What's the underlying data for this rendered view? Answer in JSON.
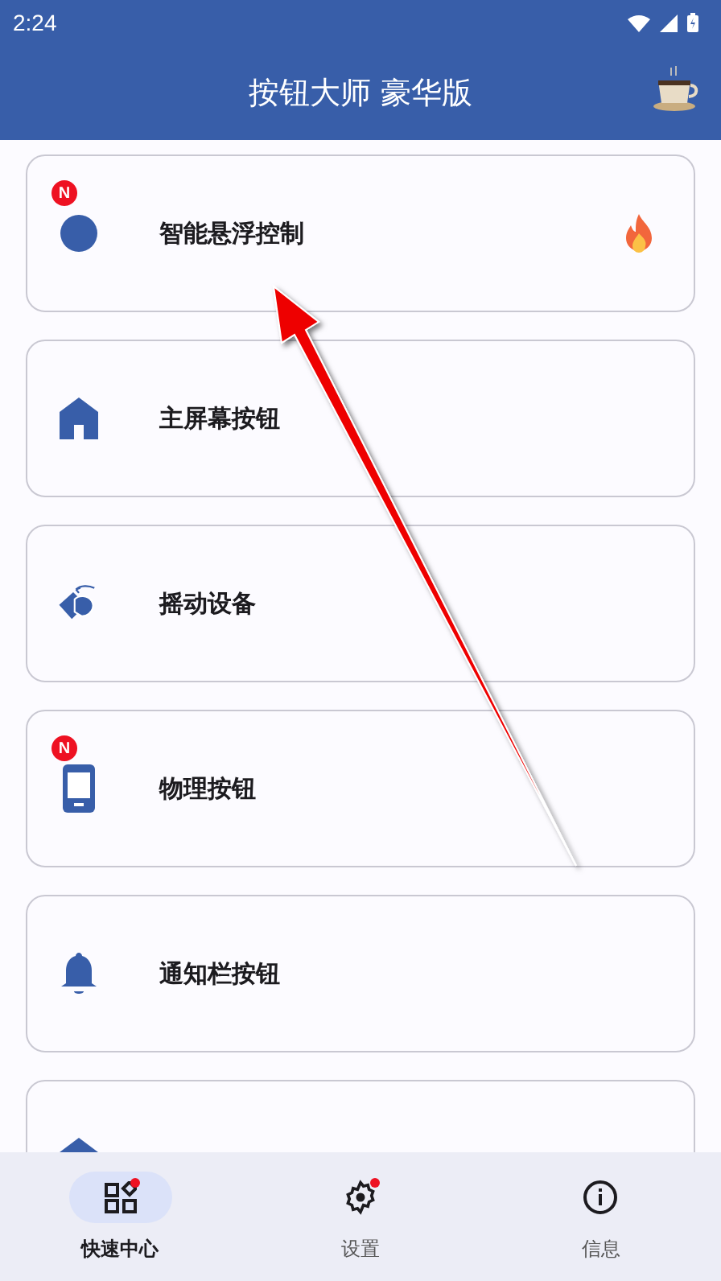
{
  "status_bar": {
    "time": "2:24"
  },
  "app_bar": {
    "title": "按钮大师 豪华版"
  },
  "cards": [
    {
      "label": "智能悬浮控制",
      "kind": "circle",
      "badge": "N",
      "hot": true
    },
    {
      "label": "主屏幕按钮",
      "kind": "home",
      "hot": false
    },
    {
      "label": "摇动设备",
      "kind": "shake",
      "hot": false
    },
    {
      "label": "物理按钮",
      "kind": "phone",
      "badge": "N",
      "hot": false
    },
    {
      "label": "通知栏按钮",
      "kind": "bell",
      "hot": false
    },
    {
      "kind": "home",
      "hot": false
    }
  ],
  "bottom_nav": [
    {
      "label": "快速中心",
      "kind": "apps",
      "selected": true,
      "dot": true
    },
    {
      "label": "设置",
      "kind": "gear",
      "selected": false,
      "dot": true
    },
    {
      "label": "信息",
      "kind": "info",
      "selected": false,
      "dot": false
    }
  ],
  "annotation": {
    "kind": "arrow"
  }
}
